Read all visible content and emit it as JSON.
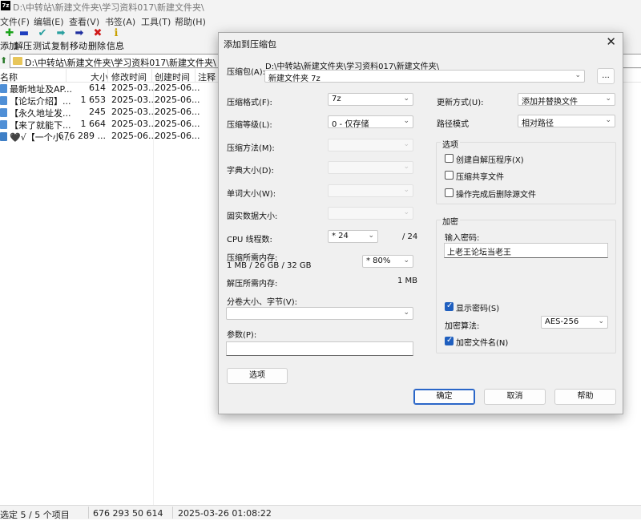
{
  "window": {
    "title": "D:\\中转站\\新建文件夹\\学习资料017\\新建文件夹\\",
    "app_icon": "7z"
  },
  "menu": [
    "文件(F)",
    "编辑(E)",
    "查看(V)",
    "书签(A)",
    "工具(T)",
    "帮助(H)"
  ],
  "toolbar": [
    {
      "label": "添加",
      "icon": "plus-icon",
      "color": "#1aa31a",
      "glyph": "✚"
    },
    {
      "label": "解压",
      "icon": "minus-icon",
      "color": "#1f3fbf",
      "glyph": "▬"
    },
    {
      "label": "测试",
      "icon": "check-icon",
      "color": "#2aa0a0",
      "glyph": "✔"
    },
    {
      "label": "复制",
      "icon": "copy-arrow-icon",
      "color": "#2aa0a0",
      "glyph": "➡"
    },
    {
      "label": "移动",
      "icon": "move-arrow-icon",
      "color": "#1f2fa0",
      "glyph": "➡"
    },
    {
      "label": "删除",
      "icon": "delete-icon",
      "color": "#d01818",
      "glyph": "✖"
    },
    {
      "label": "信息",
      "icon": "info-icon",
      "color": "#c8a000",
      "glyph": "ℹ"
    }
  ],
  "address": {
    "path": "D:\\中转站\\新建文件夹\\学习资料017\\新建文件夹\\"
  },
  "columns": {
    "name": "名称",
    "size": "大小",
    "modified": "修改时间",
    "created": "创建时间",
    "comment": "注释"
  },
  "files": [
    {
      "name": "最新地址及AP...",
      "size": "614",
      "modified": "2025-03...",
      "created": "2025-06..."
    },
    {
      "name": "【论坛介绍】...",
      "size": "1 653",
      "modified": "2025-03...",
      "created": "2025-06..."
    },
    {
      "name": "【永久地址发...",
      "size": "245",
      "modified": "2025-03...",
      "created": "2025-06..."
    },
    {
      "name": "【来了就能下...",
      "size": "1 664",
      "modified": "2025-03...",
      "created": "2025-06..."
    },
    {
      "name": "🖤√【一个小...",
      "size": "676 289 ...",
      "modified": "2025-06...",
      "created": "2025-06..."
    }
  ],
  "status": {
    "selection": "选定 5 / 5 个项目",
    "total_size": "676 293 50 614",
    "date": "2025-03-26 01:08:22"
  },
  "dialog": {
    "title": "添加到压缩包",
    "close": "✕",
    "archive_label": "压缩包(A):",
    "archive_path": "D:\\中转站\\新建文件夹\\学习资料017\\新建文件夹\\",
    "archive_name": "新建文件夹 7z",
    "browse": "...",
    "format_label": "压缩格式(F):",
    "format_value": "7z",
    "level_label": "压缩等级(L):",
    "level_value": "0 - 仅存储",
    "method_label": "压缩方法(M):",
    "dict_label": "字典大小(D):",
    "word_label": "单词大小(W):",
    "solid_label": "固实数据大小:",
    "cpu_label": "CPU 线程数:",
    "cpu_value": "* 24",
    "cpu_total": "/ 24",
    "mem_label": "压缩所需内存:",
    "mem_detail": "1 MB / 26 GB / 32 GB",
    "mem_value": "* 80%",
    "demem_label": "解压所需内存:",
    "demem_value": "1 MB",
    "split_label": "分卷大小、字节(V):",
    "params_label": "参数(P):",
    "options_button": "选项",
    "update_label": "更新方式(U):",
    "update_value": "添加并替换文件",
    "pathmode_label": "路径模式",
    "pathmode_value": "相对路径",
    "options_group": "选项",
    "opt_sfx": "创建自解压程序(X)",
    "opt_shared": "压缩共享文件",
    "opt_delete": "操作完成后删除源文件",
    "encrypt_group": "加密",
    "password_label": "输入密码:",
    "password_value": "上老王论坛当老王",
    "show_password": "显示密码(S)",
    "algo_label": "加密算法:",
    "algo_value": "AES-256",
    "encrypt_names": "加密文件名(N)",
    "ok": "确定",
    "cancel": "取消",
    "help": "帮助"
  }
}
